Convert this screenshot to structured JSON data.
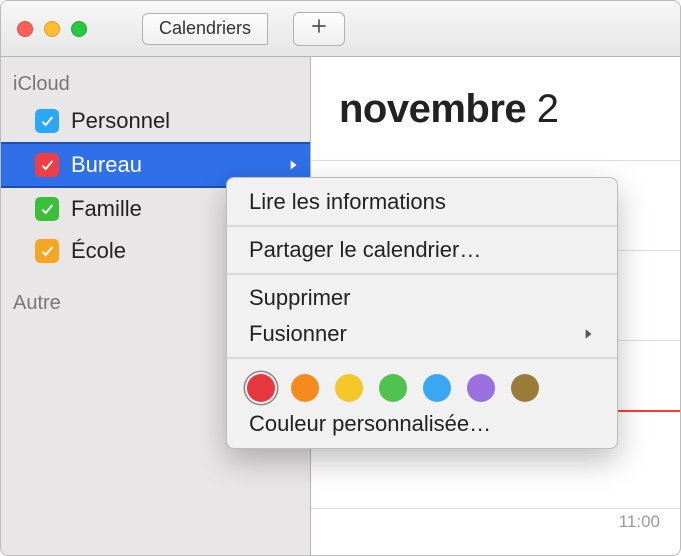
{
  "toolbar": {
    "calendars_button_label": "Calendriers"
  },
  "sidebar": {
    "groups": {
      "icloud": {
        "label": "iCloud"
      },
      "other": {
        "label": "Autre"
      }
    },
    "items": [
      {
        "label": "Personnel",
        "color": "blue"
      },
      {
        "label": "Bureau",
        "color": "red",
        "selected": true
      },
      {
        "label": "Famille",
        "color": "green"
      },
      {
        "label": "École",
        "color": "orange"
      }
    ]
  },
  "main": {
    "month": "novembre",
    "year_partial": "2",
    "visible_time_label": "11:00"
  },
  "context_menu": {
    "get_info": "Lire les informations",
    "share": "Partager le calendrier…",
    "delete": "Supprimer",
    "merge": "Fusionner",
    "custom_color": "Couleur personnalisée…",
    "swatches": [
      {
        "name": "red",
        "hex": "#e9373f",
        "selected": true
      },
      {
        "name": "orange",
        "hex": "#f58b1e"
      },
      {
        "name": "yellow",
        "hex": "#f3c62a"
      },
      {
        "name": "green",
        "hex": "#4fc24f"
      },
      {
        "name": "blue",
        "hex": "#3aa7f2"
      },
      {
        "name": "purple",
        "hex": "#9b6fe0"
      },
      {
        "name": "brown",
        "hex": "#9a7c3a"
      }
    ]
  }
}
